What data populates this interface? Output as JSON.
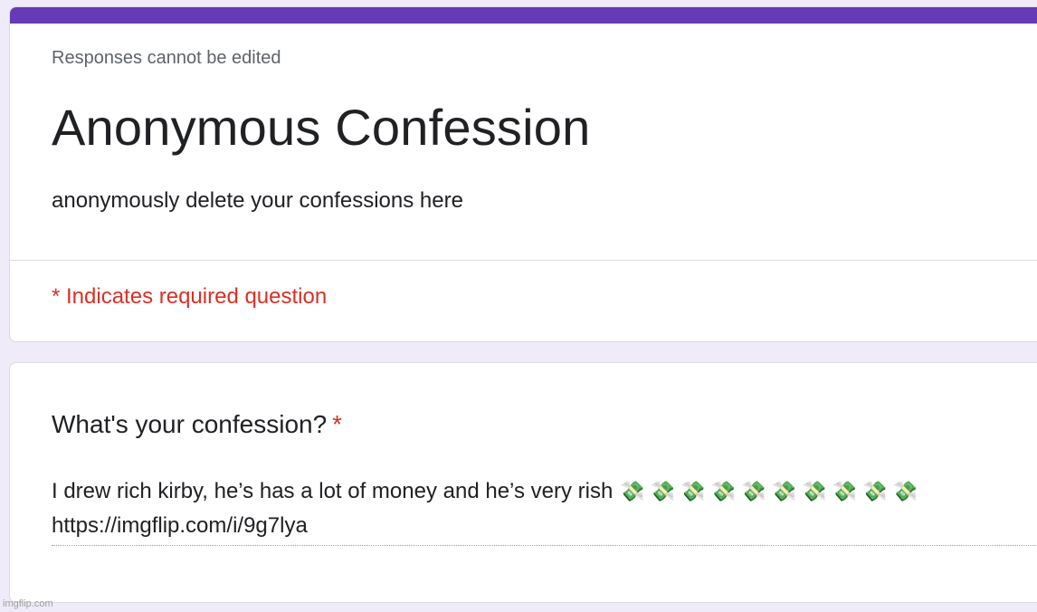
{
  "colors": {
    "theme": "#673ab7",
    "background": "#f0ebf8",
    "required": "#d93025"
  },
  "header": {
    "notice": "Responses cannot be edited",
    "title": "Anonymous Confession",
    "description": "anonymously delete your confessions here",
    "required_note": "* Indicates required question"
  },
  "question": {
    "title": "What's your confession?",
    "required_marker": "*",
    "answer": {
      "text": "I drew rich kirby, he’s has a lot of money and he’s very rish",
      "emoji": "💸 💸 💸 💸 💸 💸 💸 💸 💸 💸",
      "link": "https://imgflip.com/i/9g7lya"
    }
  },
  "watermark": "imgflip.com"
}
